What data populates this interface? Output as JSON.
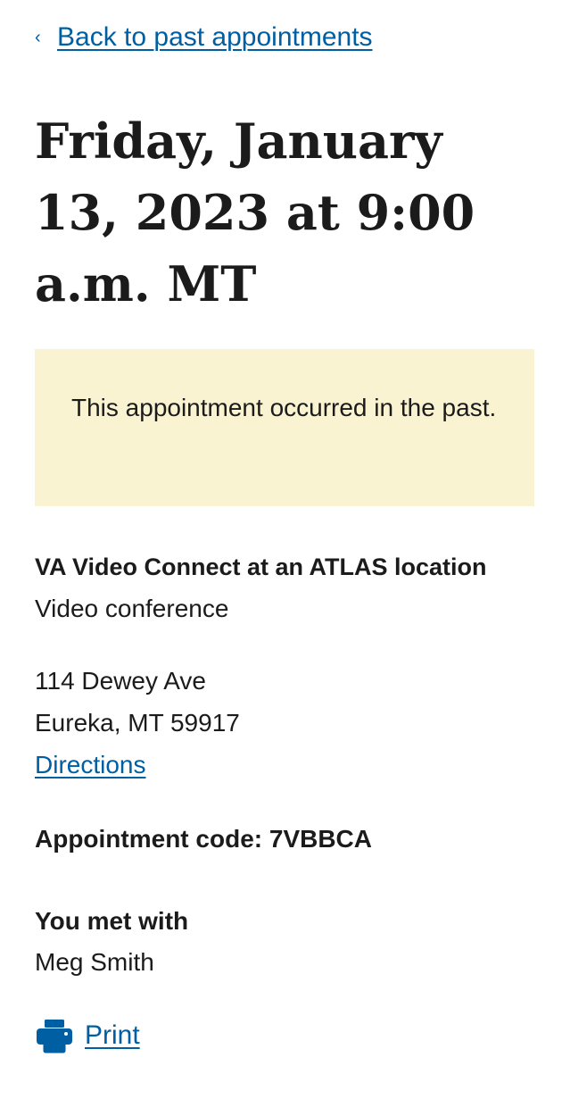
{
  "nav": {
    "back_chevron": "‹",
    "back_label": "Back to past appointments"
  },
  "appointment": {
    "title": "Friday, January 13, 2023 at 9:00 a.m. MT",
    "alert": "This appointment occurred in the past.",
    "type_heading": "VA Video Connect at an ATLAS location",
    "type_sub": "Video conference",
    "address": {
      "street": "114 Dewey Ave",
      "city_state_zip": "Eureka, MT 59917"
    },
    "directions_label": "Directions",
    "code": "Appointment code: 7VBBCA",
    "met_with_heading": "You met with",
    "provider": "Meg Smith",
    "print_label": "Print"
  },
  "icons": {
    "back": "chevron-left-icon",
    "print": "printer-icon"
  },
  "colors": {
    "link": "#005ea2",
    "alert_background": "#faf3d1",
    "text": "#1b1b1b"
  }
}
